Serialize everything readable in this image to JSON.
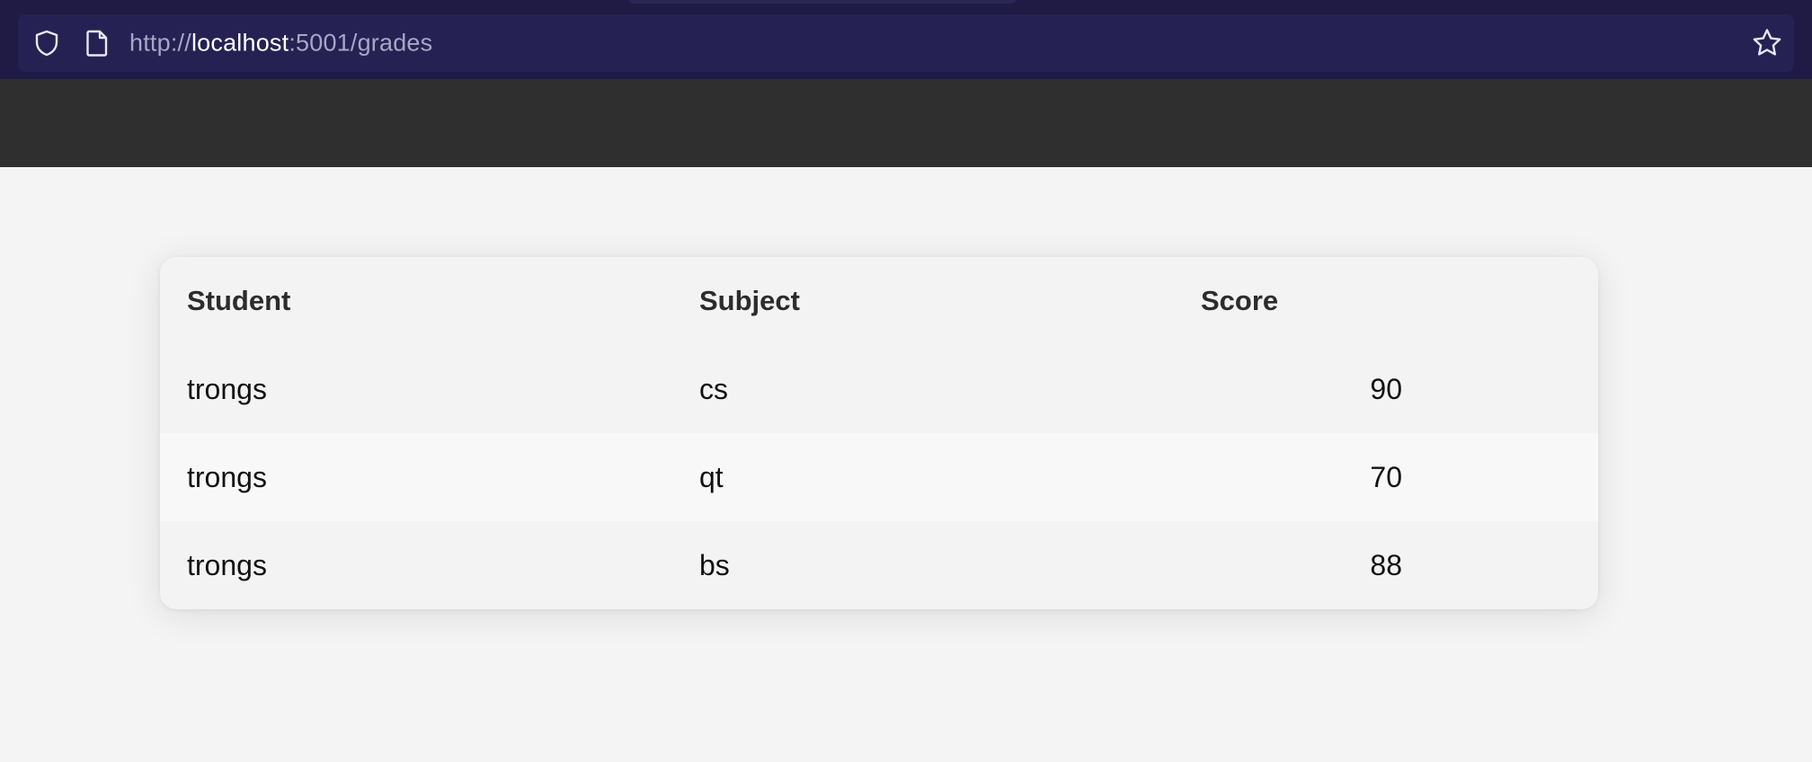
{
  "browser": {
    "url_scheme": "http://",
    "url_host": "localhost",
    "url_rest": ":5001/grades",
    "icons": {
      "shield": "shield-icon",
      "page": "page-icon",
      "bookmark": "star-icon"
    },
    "colors": {
      "chrome_bg": "#1f1b45",
      "urlbar_bg": "#252253"
    }
  },
  "app": {
    "header_color": "#2f2f2f"
  },
  "grades_table": {
    "headers": [
      "Student",
      "Subject",
      "Score"
    ],
    "rows": [
      {
        "student": "trongs",
        "subject": "cs",
        "score": "90"
      },
      {
        "student": "trongs",
        "subject": "qt",
        "score": "70"
      },
      {
        "student": "trongs",
        "subject": "bs",
        "score": "88"
      }
    ]
  }
}
